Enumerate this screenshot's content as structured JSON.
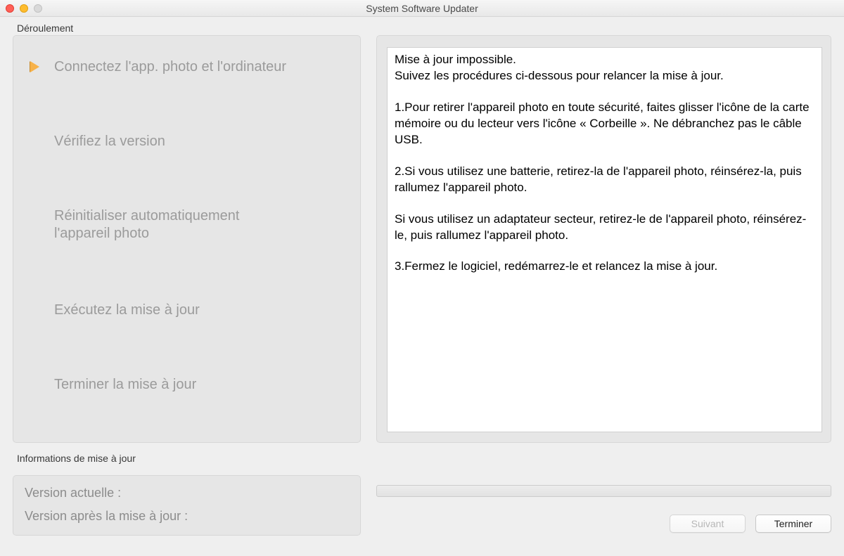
{
  "window": {
    "title": "System Software Updater"
  },
  "sections": {
    "progress_header": "Déroulement",
    "info_header": "Informations de mise à jour"
  },
  "steps": [
    {
      "label": "Connectez l'app. photo et l'ordinateur",
      "active": true
    },
    {
      "label": "Vérifiez la version",
      "active": false
    },
    {
      "label": "Réinitialiser automatiquement l'appareil photo",
      "active": false
    },
    {
      "label": "Exécutez la mise à jour",
      "active": false
    },
    {
      "label": "Terminer la mise à jour",
      "active": false
    }
  ],
  "message": {
    "p1": "Mise à jour impossible.\nSuivez les procédures ci-dessous pour relancer la mise à jour.",
    "p2": "1.Pour retirer l'appareil photo en toute sécurité, faites glisser l'icône de la carte mémoire ou du lecteur vers l'icône « Corbeille ». Ne débranchez pas le câble USB.",
    "p3": "2.Si vous utilisez une batterie, retirez-la de l'appareil photo, réinsérez-la, puis rallumez l'appareil photo.",
    "p4": "Si vous utilisez un adaptateur secteur, retirez-le de l'appareil photo, réinsérez-le, puis rallumez l'appareil photo.",
    "p5": "3.Fermez le logiciel, redémarrez-le et relancez la mise à jour."
  },
  "info": {
    "current_label": "Version actuelle :",
    "current_value": "",
    "after_label": "Version après la mise à jour :",
    "after_value": ""
  },
  "buttons": {
    "next": "Suivant",
    "finish": "Terminer"
  }
}
